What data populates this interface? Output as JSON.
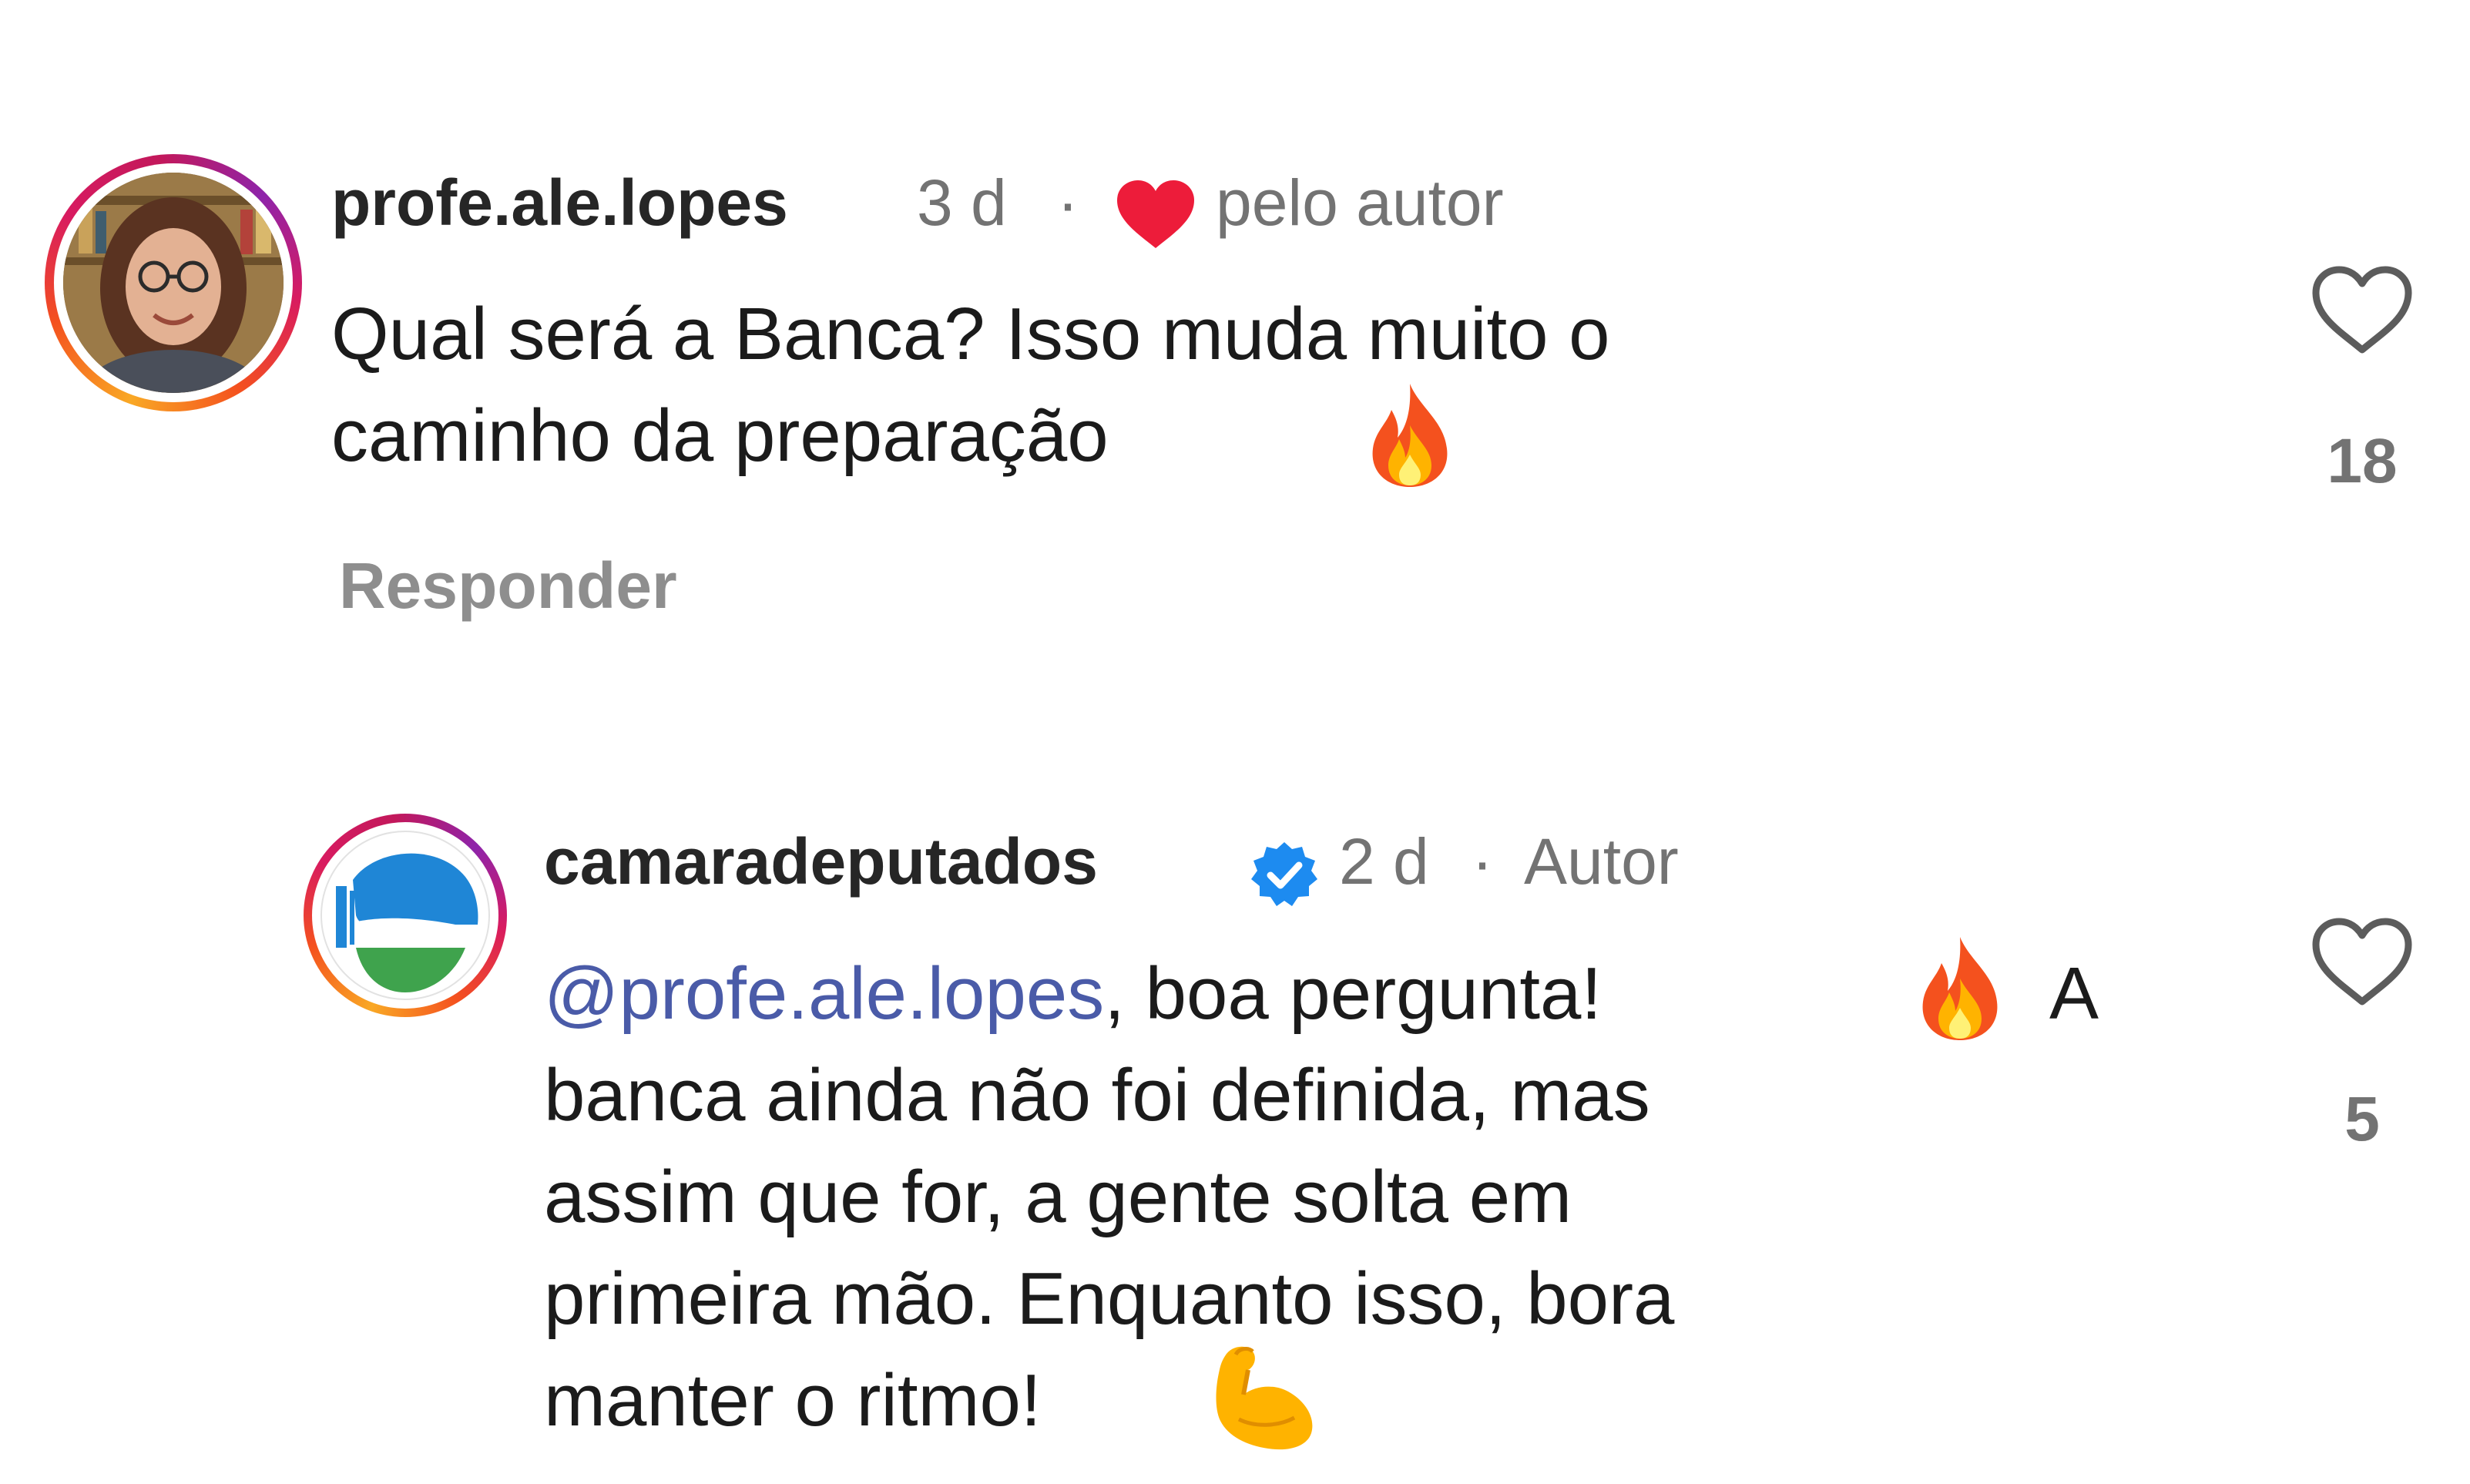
{
  "comments": [
    {
      "username": "profe.ale.lopes",
      "time": "3 d",
      "separator": "·",
      "liked_by_author_label": "pelo autor",
      "lines": [
        "Qual será a Banca? Isso muda muito o",
        "caminho da preparação"
      ],
      "emoji": "fire-emoji",
      "reply_label": "Responder",
      "like_count": "18"
    },
    {
      "username": "camaradeputados",
      "verified": true,
      "time": "2 d",
      "separator": "·",
      "role_label": "Autor",
      "mention": "@profe.ale.lopes",
      "line1_rest": ", boa pergunta!",
      "line1_tail": "A",
      "lines": [
        "banca ainda não foi definida, mas",
        "assim que for, a gente solta em",
        "primeira mão. Enquanto isso, bora",
        "manter o ritmo!"
      ],
      "emojis": [
        "fire-emoji",
        "flexed-biceps-emoji"
      ],
      "like_count": "5"
    }
  ],
  "colors": {
    "username": "#262626",
    "meta": "#737373",
    "mention": "#4a5ba8",
    "heart_red": "#ed1c3a",
    "verified_blue": "#1d8bf0"
  }
}
